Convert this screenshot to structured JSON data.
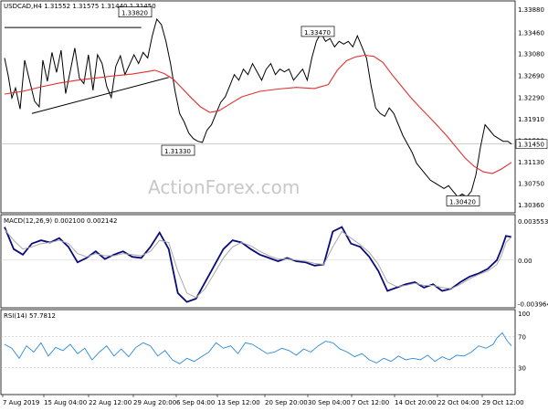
{
  "watermark": "ActionForex.com",
  "chart_data": [
    {
      "type": "candlestick",
      "header": "USDCAD,H4  1.31552 1.31575 1.31440 1.31450",
      "price_ticks": [
        "1.33880",
        "1.33460",
        "1.33080",
        "1.32690",
        "1.32290",
        "1.31910",
        "1.31520",
        "1.31130",
        "1.30750",
        "1.30360"
      ],
      "current_price": "1.31450",
      "ylim": [
        1.3036,
        1.3388
      ],
      "x_labels": [
        "7 Aug 2019",
        "15 Aug 04:00",
        "22 Aug 12:00",
        "29 Aug 20:00",
        "6 Sep 04:00",
        "13 Sep 12:00",
        "20 Sep 20:00",
        "30 Sep 04:00",
        "7 Oct 12:00",
        "14 Oct 20:00",
        "22 Oct 04:00",
        "29 Oct 12:00"
      ],
      "annotations": [
        "1.33820",
        "1.31330",
        "1.33470",
        "1.30420"
      ],
      "series": [
        {
          "name": "price",
          "color": "#000000",
          "x": [
            0,
            4,
            8,
            12,
            17,
            22,
            28,
            33,
            38,
            42,
            47,
            52,
            57,
            62,
            67,
            72,
            77,
            82,
            87,
            92,
            97,
            102,
            107,
            112,
            117,
            122,
            127,
            132,
            137,
            142,
            147,
            152,
            157,
            162,
            167,
            172,
            177,
            182,
            187,
            192,
            197,
            202,
            207,
            212,
            217,
            222,
            227,
            232,
            237,
            242,
            247,
            252,
            257,
            262,
            267,
            272,
            277,
            282,
            287,
            292,
            297,
            302,
            307,
            312,
            317,
            322,
            327,
            332,
            337,
            342,
            347,
            352,
            357,
            362,
            367,
            372,
            377,
            382,
            387,
            392,
            397,
            402,
            407,
            412,
            417,
            422,
            427,
            432,
            437,
            442,
            447,
            452,
            457,
            462,
            467,
            472,
            477,
            482,
            487,
            492,
            497,
            502,
            507,
            512,
            517,
            522,
            527,
            532,
            537,
            542,
            547,
            552,
            556
          ],
          "y": [
            1.33,
            1.3268,
            1.3228,
            1.3246,
            1.3208,
            1.3296,
            1.3256,
            1.3222,
            1.3212,
            1.3296,
            1.3258,
            1.331,
            1.3274,
            1.3314,
            1.3236,
            1.3276,
            1.3318,
            1.3264,
            1.3254,
            1.3306,
            1.3242,
            1.3306,
            1.329,
            1.3249,
            1.3229,
            1.3285,
            1.3304,
            1.327,
            1.3288,
            1.3306,
            1.329,
            1.331,
            1.33,
            1.334,
            1.337,
            1.336,
            1.333,
            1.329,
            1.324,
            1.32,
            1.3185,
            1.3165,
            1.3155,
            1.315,
            1.3148,
            1.317,
            1.318,
            1.32,
            1.322,
            1.323,
            1.325,
            1.327,
            1.326,
            1.328,
            1.327,
            1.329,
            1.3275,
            1.326,
            1.328,
            1.329,
            1.327,
            1.328,
            1.3275,
            1.328,
            1.326,
            1.327,
            1.328,
            1.326,
            1.33,
            1.333,
            1.3345,
            1.333,
            1.3335,
            1.332,
            1.333,
            1.3325,
            1.333,
            1.332,
            1.334,
            1.332,
            1.33,
            1.325,
            1.321,
            1.32,
            1.3195,
            1.321,
            1.32,
            1.318,
            1.316,
            1.3145,
            1.313,
            1.311,
            1.31,
            1.309,
            1.308,
            1.3075,
            1.307,
            1.3065,
            1.307,
            1.306,
            1.305,
            1.3055,
            1.305,
            1.306,
            1.309,
            1.314,
            1.318,
            1.317,
            1.316,
            1.3155,
            1.315,
            1.315,
            1.3145
          ]
        },
        {
          "name": "moving-average",
          "color": "#e03030",
          "x": [
            0,
            20,
            40,
            60,
            80,
            100,
            120,
            140,
            155,
            165,
            175,
            185,
            195,
            205,
            215,
            225,
            235,
            245,
            260,
            280,
            300,
            320,
            340,
            355,
            365,
            375,
            385,
            395,
            405,
            415,
            425,
            435,
            445,
            455,
            465,
            475,
            485,
            495,
            505,
            515,
            525,
            535,
            545,
            556
          ],
          "y": [
            1.3235,
            1.324,
            1.3248,
            1.3255,
            1.326,
            1.3264,
            1.3268,
            1.3271,
            1.3275,
            1.3278,
            1.3272,
            1.3262,
            1.3245,
            1.3228,
            1.3212,
            1.3202,
            1.3205,
            1.3215,
            1.323,
            1.324,
            1.3244,
            1.3247,
            1.3245,
            1.3252,
            1.3278,
            1.3295,
            1.3302,
            1.3305,
            1.3303,
            1.3292,
            1.327,
            1.325,
            1.323,
            1.3212,
            1.3195,
            1.3178,
            1.316,
            1.314,
            1.312,
            1.3105,
            1.3095,
            1.3092,
            1.31,
            1.3112
          ]
        }
      ]
    },
    {
      "type": "line",
      "label": "MACD(12,26,9) 0.002100 0.002142",
      "y_ticks": [
        "0.003553",
        "0.00",
        "-0.003964"
      ],
      "ylim": [
        -0.004,
        0.0038
      ],
      "series": [
        {
          "name": "macd",
          "color": "#0a0a7a",
          "x": [
            0,
            10,
            20,
            30,
            40,
            50,
            60,
            70,
            80,
            90,
            100,
            110,
            120,
            130,
            140,
            150,
            160,
            170,
            180,
            190,
            200,
            210,
            220,
            230,
            240,
            250,
            260,
            270,
            280,
            290,
            300,
            310,
            320,
            330,
            340,
            350,
            360,
            370,
            380,
            390,
            400,
            410,
            420,
            430,
            440,
            450,
            460,
            470,
            480,
            490,
            500,
            510,
            520,
            530,
            540,
            545,
            550,
            556
          ],
          "y": [
            0.003,
            0.001,
            0.0005,
            0.0015,
            0.0018,
            0.0016,
            0.002,
            0.0012,
            -0.0002,
            0.0002,
            0.0008,
            0.0001,
            0.0005,
            0.0008,
            0.0003,
            0.0002,
            0.0012,
            0.0025,
            0.001,
            -0.003,
            -0.0038,
            -0.0035,
            -0.002,
            -0.0005,
            0.001,
            0.0018,
            0.0016,
            0.001,
            0.0005,
            0.0002,
            -0.0001,
            0.0002,
            -0.0001,
            -0.0002,
            -0.0005,
            -0.0004,
            0.0026,
            0.003,
            0.0015,
            0.0012,
            0.0003,
            -0.001,
            -0.0028,
            -0.0025,
            -0.0022,
            -0.002,
            -0.0025,
            -0.0022,
            -0.0028,
            -0.0026,
            -0.002,
            -0.0015,
            -0.0012,
            -0.0008,
            0.0,
            0.001,
            0.0022,
            0.0021
          ]
        },
        {
          "name": "signal",
          "color": "#a8a8a8",
          "x": [
            0,
            10,
            20,
            30,
            40,
            50,
            60,
            70,
            80,
            90,
            100,
            110,
            120,
            130,
            140,
            150,
            160,
            170,
            180,
            190,
            200,
            210,
            220,
            230,
            240,
            250,
            260,
            270,
            280,
            290,
            300,
            310,
            320,
            330,
            340,
            350,
            360,
            370,
            380,
            390,
            400,
            410,
            420,
            430,
            440,
            450,
            460,
            470,
            480,
            490,
            500,
            510,
            520,
            530,
            540,
            545,
            550,
            556
          ],
          "y": [
            0.0028,
            0.0018,
            0.001,
            0.0012,
            0.0015,
            0.0016,
            0.0018,
            0.0015,
            0.0006,
            0.0003,
            0.0006,
            0.0004,
            0.0004,
            0.0006,
            0.0005,
            0.0004,
            0.0008,
            0.0018,
            0.0016,
            -0.001,
            -0.003,
            -0.0034,
            -0.0026,
            -0.0012,
            0.0002,
            0.0012,
            0.0016,
            0.0013,
            0.0008,
            0.0004,
            0.0001,
            0.0001,
            0.0,
            -0.0001,
            -0.0003,
            -0.0004,
            0.0012,
            0.0026,
            0.002,
            0.0014,
            0.0007,
            -0.0004,
            -0.002,
            -0.0024,
            -0.0023,
            -0.0021,
            -0.0023,
            -0.0023,
            -0.0025,
            -0.0026,
            -0.0022,
            -0.0017,
            -0.0013,
            -0.001,
            -0.0004,
            0.0004,
            0.0016,
            0.0021
          ]
        }
      ]
    },
    {
      "type": "line",
      "label": "RSI(14) 57.7812",
      "y_ticks": [
        "100",
        "70",
        "30",
        "0"
      ],
      "ylim": [
        0,
        100
      ],
      "series": [
        {
          "name": "rsi",
          "color": "#2a8ad8",
          "x": [
            0,
            8,
            16,
            24,
            32,
            40,
            48,
            56,
            64,
            72,
            80,
            88,
            96,
            104,
            112,
            120,
            128,
            136,
            144,
            152,
            160,
            168,
            176,
            184,
            192,
            200,
            208,
            216,
            224,
            232,
            240,
            248,
            256,
            264,
            272,
            280,
            288,
            296,
            304,
            312,
            320,
            328,
            336,
            344,
            352,
            360,
            368,
            376,
            384,
            392,
            400,
            408,
            416,
            424,
            432,
            440,
            448,
            456,
            464,
            472,
            480,
            488,
            496,
            504,
            512,
            520,
            528,
            536,
            540,
            546,
            551,
            556
          ],
          "y": [
            60,
            55,
            42,
            58,
            50,
            62,
            45,
            56,
            52,
            60,
            48,
            55,
            40,
            50,
            58,
            45,
            54,
            44,
            56,
            62,
            58,
            45,
            52,
            40,
            35,
            42,
            38,
            44,
            50,
            62,
            55,
            58,
            48,
            62,
            60,
            54,
            48,
            50,
            55,
            52,
            46,
            54,
            50,
            58,
            64,
            62,
            54,
            50,
            44,
            48,
            40,
            36,
            42,
            38,
            45,
            40,
            42,
            40,
            46,
            38,
            44,
            40,
            46,
            45,
            50,
            58,
            55,
            60,
            68,
            75,
            65,
            58
          ]
        }
      ]
    }
  ]
}
